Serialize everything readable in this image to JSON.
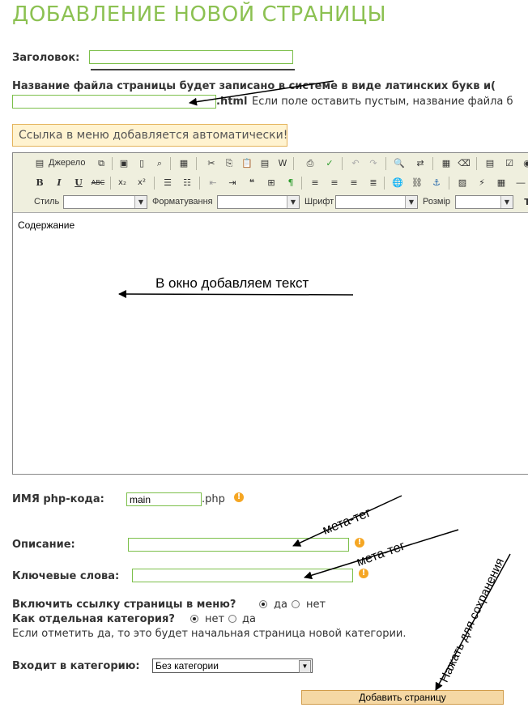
{
  "page": {
    "title": "ДОБАВЛЕНИЕ НОВОЙ СТРАНИЦЫ"
  },
  "form": {
    "title_label": "Заголовок:",
    "title_value": "",
    "filename_label": "Название файла страницы будет записано в системе в виде латинских букв и(",
    "filename_value": "",
    "filename_ext": ".html",
    "filename_hint": "Если поле оставить пустым, название файла б",
    "notice": "Ссылка в меню добавляется автоматически!",
    "php_label": "ИМЯ php-кода:",
    "php_value": "main",
    "php_ext": ".php",
    "description_label": "Описание:",
    "description_value": "",
    "keywords_label": "Ключевые слова:",
    "keywords_value": "",
    "menu_link_label": "Включить ссылку страницы в меню?",
    "menu_link_yes": "да",
    "menu_link_no": "нет",
    "separate_cat_label": "Как отдельная категория?",
    "separate_cat_no": "нет",
    "separate_cat_yes": "да",
    "separate_cat_hint": "Если отметить да, то это будет начальная страница новой категории.",
    "category_label": "Входит в категорию:",
    "category_value": "Без категории",
    "submit_label": "Добавить страницу",
    "warn_glyph": "!"
  },
  "editor": {
    "source_label": "Джерело",
    "style_label": "Стиль",
    "format_label": "Форматування",
    "font_label": "Шрифт",
    "size_label": "Розмір",
    "content": "Содержание",
    "bold": "B",
    "italic": "I",
    "underline": "U",
    "strike": "ABC",
    "sub": "x₂",
    "sup": "x²",
    "dd_arrow": "▼"
  },
  "annotations": {
    "editor_note": "В окно добавляем текст",
    "meta1": "мета-тег",
    "meta2": "мета-тег",
    "save_note": "Нажать для сохранения"
  },
  "colors": {
    "title": "#8cc152",
    "input_border": "#7cbf4a",
    "notice_bg": "#fff3d0",
    "submit_bg": "#f5d8a4"
  }
}
